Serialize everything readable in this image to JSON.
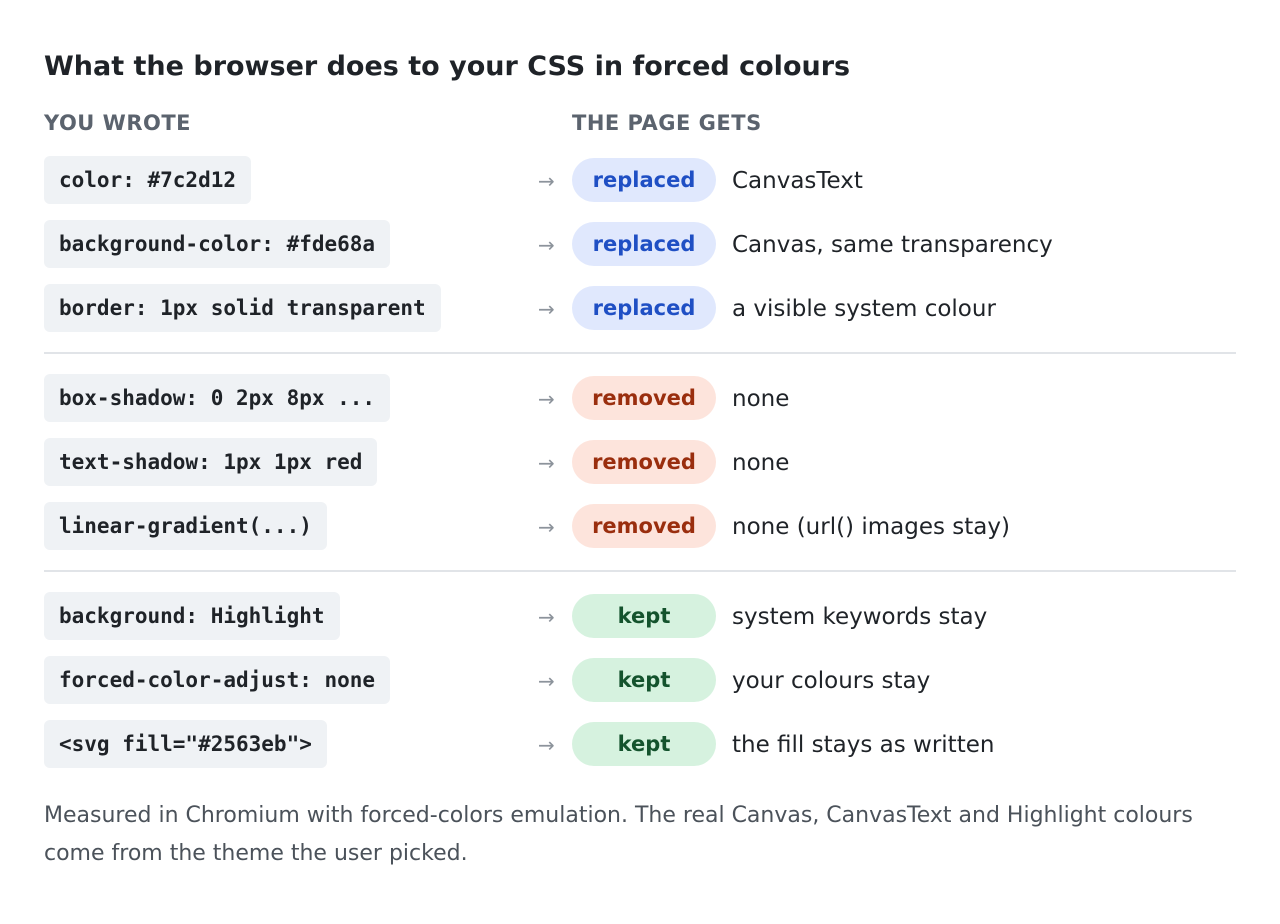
{
  "title": "What the browser does to your CSS in forced colours",
  "columns": {
    "left": "YOU WROTE",
    "right": "THE PAGE GETS"
  },
  "arrow": "→",
  "rows": [
    {
      "code": "color: #7c2d12",
      "status": "replaced",
      "result": "CanvasText"
    },
    {
      "code": "background-color: #fde68a",
      "status": "replaced",
      "result": "Canvas, same transparency"
    },
    {
      "code": "border: 1px solid transparent",
      "status": "replaced",
      "result": "a visible system colour"
    },
    {
      "code": "box-shadow: 0 2px 8px ...",
      "status": "removed",
      "result": "none"
    },
    {
      "code": "text-shadow: 1px 1px red",
      "status": "removed",
      "result": "none"
    },
    {
      "code": "linear-gradient(...)",
      "status": "removed",
      "result": "none (url() images stay)"
    },
    {
      "code": "background: Highlight",
      "status": "kept",
      "result": "system keywords stay"
    },
    {
      "code": "forced-color-adjust: none",
      "status": "kept",
      "result": "your colours stay"
    },
    {
      "code": "<svg fill=\"#2563eb\">",
      "status": "kept",
      "result": "the fill stays as written"
    }
  ],
  "footnote": "Measured in Chromium with forced-colors emulation. The real Canvas, CanvasText and Highlight colours come from the theme the user picked.",
  "colors": {
    "replaced_bg": "#e0e8fd",
    "replaced_fg": "#1f4fc4",
    "removed_bg": "#fde4dc",
    "removed_fg": "#9a2e0e",
    "kept_bg": "#d6f2df",
    "kept_fg": "#14532d"
  }
}
